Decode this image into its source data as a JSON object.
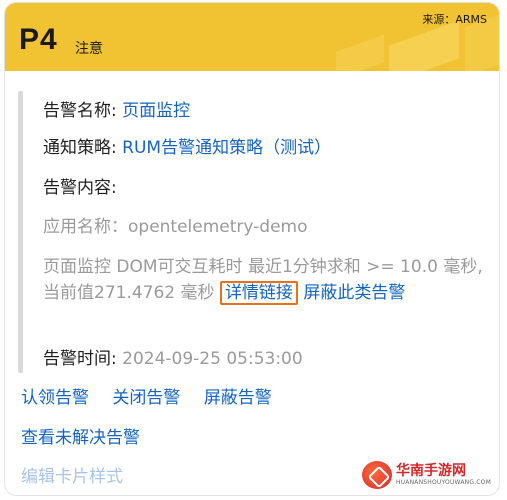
{
  "header": {
    "severity": "P4",
    "severity_label": "注意",
    "source": "来源：ARMS",
    "color": "#f1c232"
  },
  "fields": {
    "alert_name_label": "告警名称:",
    "alert_name_value": "页面监控",
    "policy_label": "通知策略:",
    "policy_value": "RUM告警通知策略（测试）",
    "content_label": "告警内容:",
    "app_name": "应用名称：opentelemetry-demo",
    "message_text": "页面监控 DOM可交互耗时 最近1分钟求和 >= 10.0 毫秒, 当前值271.4762 毫秒",
    "detail_link": "详情链接",
    "shield_link": "屏蔽此类告警",
    "time_label": "告警时间:",
    "time_value": "2024-09-25 05:53:00"
  },
  "actions": {
    "claim": "认领告警",
    "close": "关闭告警",
    "shield": "屏蔽告警",
    "view_unresolved": "查看未解决告警",
    "edit_card": "编辑卡片样式"
  },
  "watermark": {
    "name": "华南手游网",
    "url": "HUANANSHOUYOUWANG.COM"
  },
  "colors": {
    "link": "#1565c0",
    "highlight_border": "#e8711c",
    "muted": "#9a9a9a"
  }
}
